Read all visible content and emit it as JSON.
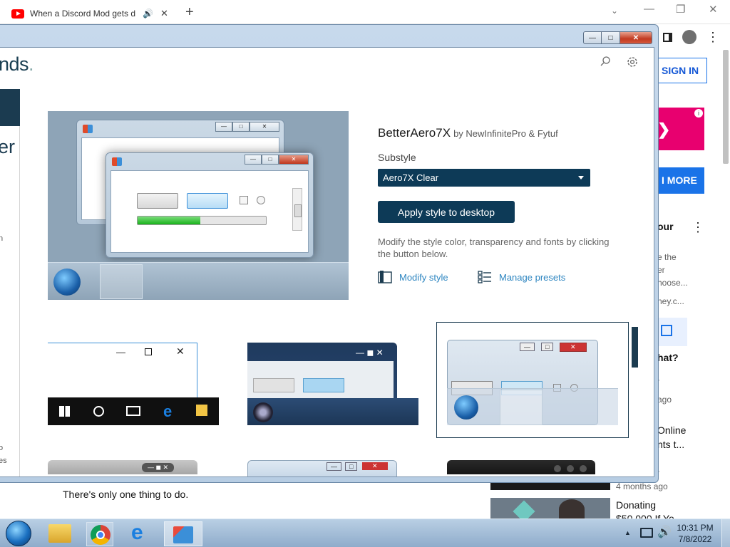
{
  "browser": {
    "tab_title": "When a Discord Mod gets d",
    "audio_icon": "🔊",
    "close_icon": "✕",
    "new_tab": "+",
    "minimize": "—",
    "restore": "❐",
    "close": "✕"
  },
  "window": {
    "min": "—",
    "max": "□",
    "close": "✕"
  },
  "app": {
    "brand": "nds",
    "left_big": "er"
  },
  "style": {
    "name": "BetterAero7X",
    "author": "by NewInfinitePro & Fytuf",
    "substyle_label": "Substyle",
    "substyle_value": "Aero7X Clear",
    "apply_label": "Apply style to desktop",
    "modify_desc": "Modify the style color, transparency and fonts by clicking the button below.",
    "modify_label": "Modify style",
    "presets_label": "Manage presets"
  },
  "preview": {
    "progress_fraction": 0.49
  },
  "youtube": {
    "sign_in": "SIGN IN",
    "ad_arrow": "❯",
    "ad_info": "i",
    "more_btn": "I MORE",
    "side_title_1": "our",
    "side_line_1": "e the",
    "side_line_2": "er",
    "side_line_3": "hoose...",
    "side_line_4": "ney.c...",
    "side_title_2": "hat?",
    "dot_1": "·",
    "ago_1": "ago",
    "side_title_3": "Online",
    "side_title_4": "nts t...",
    "dot_2": "·",
    "video_caption": "There's only one thing to do.",
    "meta_ago": "4 months ago",
    "donating_1": "Donating",
    "donating_2": "$50,000 If Yo..."
  },
  "taskbar": {
    "time": "10:31 PM",
    "date": "7/8/2022",
    "tray_arrow": "▲"
  }
}
